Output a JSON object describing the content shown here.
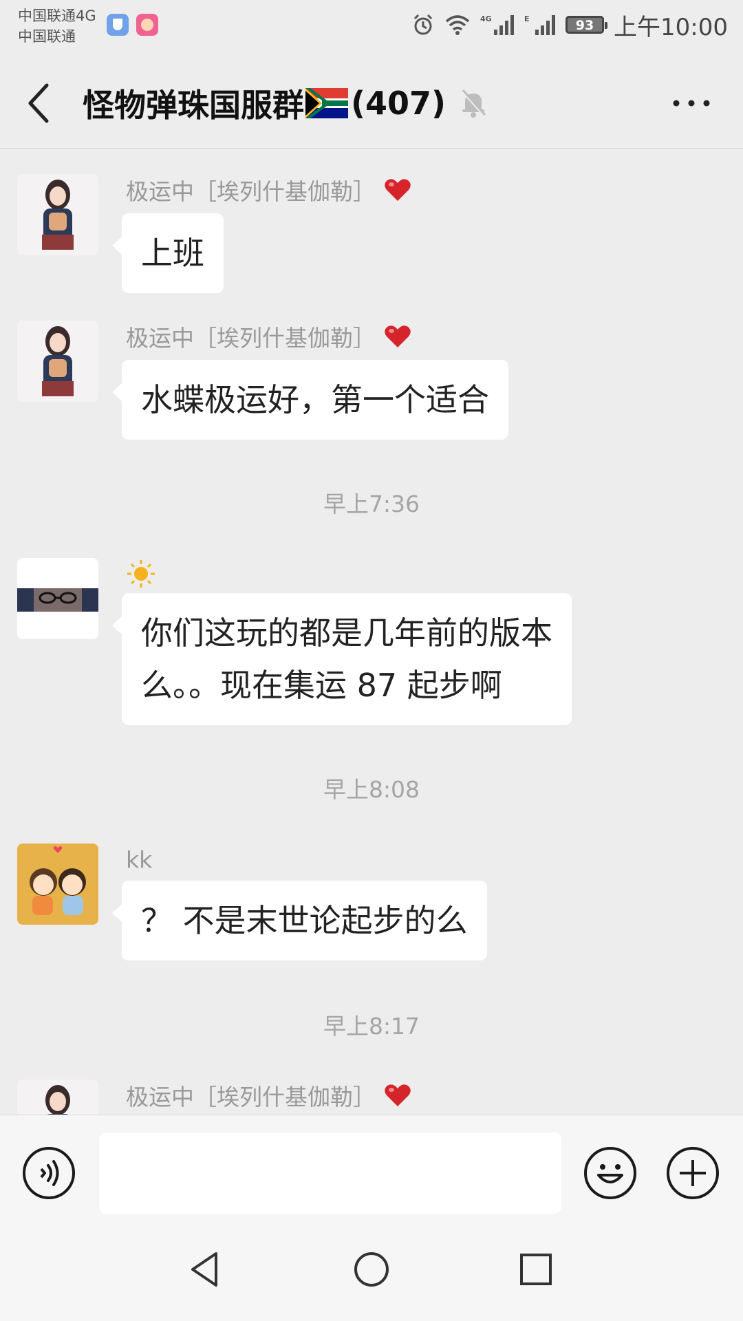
{
  "status_bar": {
    "carrier_line1": "中国联通4G",
    "carrier_line2": "中国联通",
    "battery": "93",
    "time": "上午10:00",
    "icons": [
      "shield-app-icon",
      "face-app-icon",
      "alarm-icon",
      "wifi-icon",
      "signal-4g-icon",
      "signal-e-icon",
      "battery-icon"
    ]
  },
  "header": {
    "title": "怪物弹珠国服群",
    "flag_icon": "south-africa-flag-icon",
    "member_count": "(407)",
    "muted_icon": "bell-off-icon",
    "more_icon": "more-dots-icon"
  },
  "messages": [
    {
      "type": "message",
      "sender": "极运中［埃列什基伽勒］",
      "heart": "❤️",
      "avatar": "girl-avatar",
      "text": "上班"
    },
    {
      "type": "message",
      "sender": "极运中［埃列什基伽勒］",
      "heart": "❤️",
      "avatar": "girl-avatar",
      "text": "水蝶极运好，第一个适合"
    },
    {
      "type": "time",
      "text": "早上7:36"
    },
    {
      "type": "message",
      "sender": "☀️",
      "avatar": "glasses-avatar",
      "line1": "你们这玩的都是几年前的版本",
      "line2": "么。。现在集运 87 起步啊"
    },
    {
      "type": "time",
      "text": "早上8:08"
    },
    {
      "type": "message",
      "sender": "kk",
      "avatar": "couple-avatar",
      "text": "？ 不是末世论起步的么"
    },
    {
      "type": "time",
      "text": "早上8:17"
    },
    {
      "type": "message",
      "sender": "极运中［埃列什基伽勒］",
      "heart": "❤️",
      "avatar": "girl-avatar",
      "text": ""
    }
  ],
  "input_bar": {
    "placeholder": "",
    "voice_icon": "voice-icon",
    "emoji_icon": "emoji-icon",
    "plus_icon": "plus-icon"
  },
  "nav_bar": {
    "icons": [
      "nav-back-icon",
      "nav-home-icon",
      "nav-recent-icon"
    ]
  },
  "colors": {
    "background": "#ededed",
    "bubble": "#ffffff",
    "secondary_text": "#999999",
    "bar": "#f6f6f6"
  }
}
